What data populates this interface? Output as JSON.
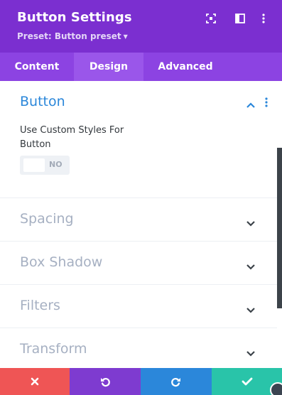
{
  "header": {
    "title": "Button Settings",
    "preset_label": "Preset: Button preset",
    "bg_color": "#7b2fd0",
    "icons": [
      "fullscreen-icon",
      "sidebar-layout-icon",
      "more-vertical-icon"
    ]
  },
  "tabs": [
    {
      "label": "Content",
      "active": false
    },
    {
      "label": "Design",
      "active": true
    },
    {
      "label": "Advanced",
      "active": false
    }
  ],
  "sections": [
    {
      "title": "Button",
      "expanded": true
    },
    {
      "title": "Spacing",
      "expanded": false
    },
    {
      "title": "Box Shadow",
      "expanded": false
    },
    {
      "title": "Filters",
      "expanded": false
    },
    {
      "title": "Transform",
      "expanded": false
    }
  ],
  "button_section": {
    "option_label": "Use Custom Styles For Button",
    "toggle_value": "NO"
  },
  "footer": {
    "buttons": [
      {
        "name": "cancel",
        "icon": "close-icon",
        "color": "#ef5555"
      },
      {
        "name": "undo",
        "icon": "undo-icon",
        "color": "#7e3bd0"
      },
      {
        "name": "redo",
        "icon": "redo-icon",
        "color": "#2b87da"
      },
      {
        "name": "save",
        "icon": "check-icon",
        "color": "#29c4a9"
      }
    ]
  },
  "accent_color": "#2b87da"
}
